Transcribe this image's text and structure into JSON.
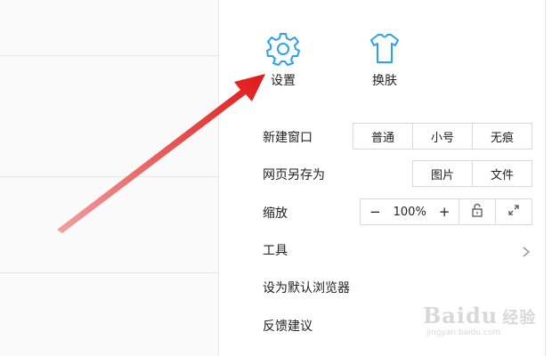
{
  "top_actions": [
    {
      "label": "设置",
      "icon": "gear-icon"
    },
    {
      "label": "换肤",
      "icon": "shirt-icon"
    }
  ],
  "rows": {
    "new_window": {
      "label": "新建窗口",
      "options": [
        "普通",
        "小号",
        "无痕"
      ]
    },
    "save_as": {
      "label": "网页另存为",
      "options": [
        "图片",
        "文件"
      ]
    },
    "zoom": {
      "label": "缩放",
      "minus": "−",
      "value": "100%",
      "plus": "+"
    },
    "tools": {
      "label": "工具"
    },
    "default_browser": {
      "label": "设为默认浏览器"
    },
    "feedback": {
      "label": "反馈建议"
    }
  },
  "watermark": {
    "brand": "Baidu",
    "sub": "经验",
    "url": "jingyan.baidu.com"
  },
  "colors": {
    "icon_accent": "#2aa3ef",
    "arrow": "#e02020"
  }
}
